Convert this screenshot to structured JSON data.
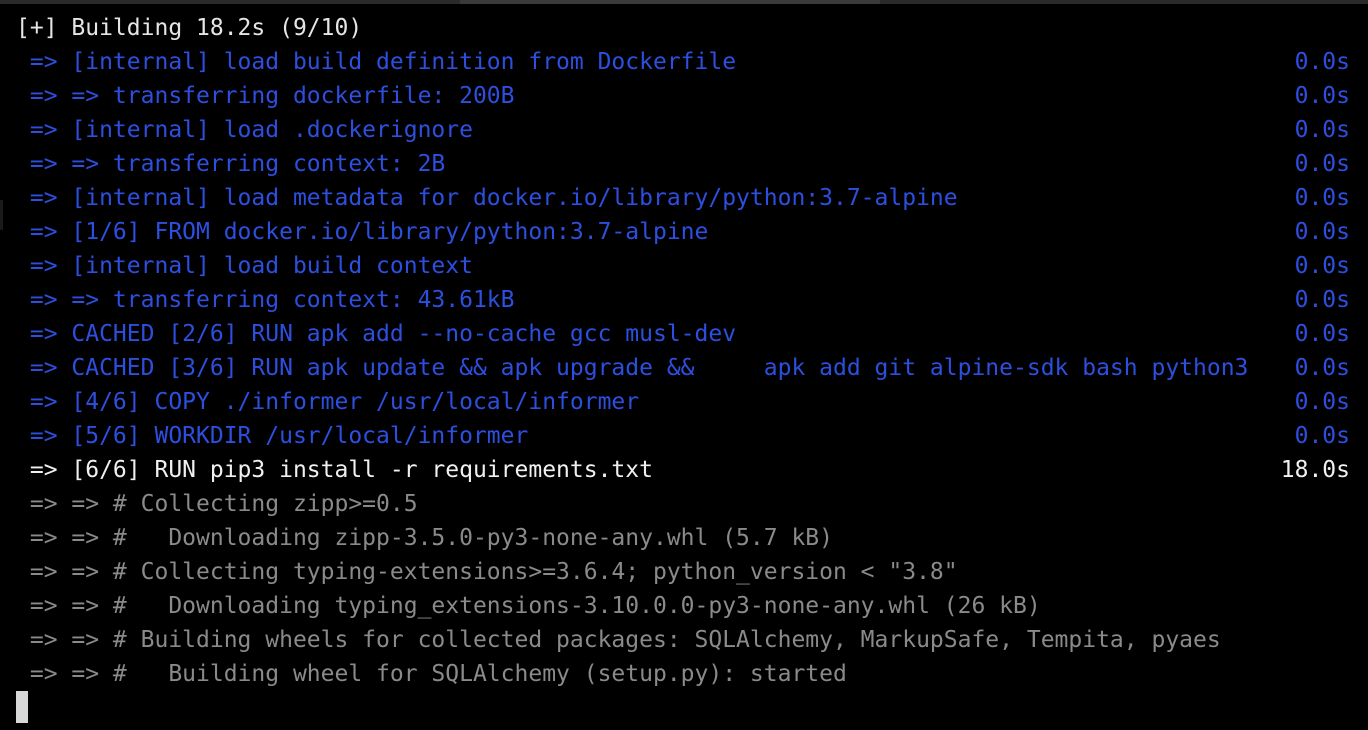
{
  "terminal": {
    "header": "[+] Building 18.2s (9/10)",
    "lines": [
      {
        "state": "done",
        "text": " => [internal] load build definition from Dockerfile",
        "time": "0.0s"
      },
      {
        "state": "done",
        "text": " => => transferring dockerfile: 200B",
        "time": "0.0s"
      },
      {
        "state": "done",
        "text": " => [internal] load .dockerignore",
        "time": "0.0s"
      },
      {
        "state": "done",
        "text": " => => transferring context: 2B",
        "time": "0.0s"
      },
      {
        "state": "done",
        "text": " => [internal] load metadata for docker.io/library/python:3.7-alpine",
        "time": "0.0s"
      },
      {
        "state": "done",
        "text": " => [1/6] FROM docker.io/library/python:3.7-alpine",
        "time": "0.0s"
      },
      {
        "state": "done",
        "text": " => [internal] load build context",
        "time": "0.0s"
      },
      {
        "state": "done",
        "text": " => => transferring context: 43.61kB",
        "time": "0.0s"
      },
      {
        "state": "done",
        "text": " => CACHED [2/6] RUN apk add --no-cache gcc musl-dev",
        "time": "0.0s"
      },
      {
        "state": "done",
        "text": " => CACHED [3/6] RUN apk update && apk upgrade &&     apk add git alpine-sdk bash python3",
        "time": "0.0s"
      },
      {
        "state": "done",
        "text": " => [4/6] COPY ./informer /usr/local/informer",
        "time": "0.0s"
      },
      {
        "state": "done",
        "text": " => [5/6] WORKDIR /usr/local/informer",
        "time": "0.0s"
      },
      {
        "state": "active",
        "text": " => [6/6] RUN pip3 install -r requirements.txt",
        "time": "18.0s"
      },
      {
        "state": "log",
        "text": " => => # Collecting zipp>=0.5",
        "time": ""
      },
      {
        "state": "log",
        "text": " => => #   Downloading zipp-3.5.0-py3-none-any.whl (5.7 kB)",
        "time": ""
      },
      {
        "state": "log",
        "text": " => => # Collecting typing-extensions>=3.6.4; python_version < \"3.8\"",
        "time": ""
      },
      {
        "state": "log",
        "text": " => => #   Downloading typing_extensions-3.10.0.0-py3-none-any.whl (26 kB)",
        "time": ""
      },
      {
        "state": "log",
        "text": " => => # Building wheels for collected packages: SQLAlchemy, MarkupSafe, Tempita, pyaes",
        "time": ""
      },
      {
        "state": "log",
        "text": " => => #   Building wheel for SQLAlchemy (setup.py): started",
        "time": ""
      }
    ]
  },
  "colors": {
    "background": "#000000",
    "done": "#2d4fe0",
    "active": "#f0f0f0",
    "log": "#8a8a8a",
    "cursor": "#d8d8d8"
  }
}
